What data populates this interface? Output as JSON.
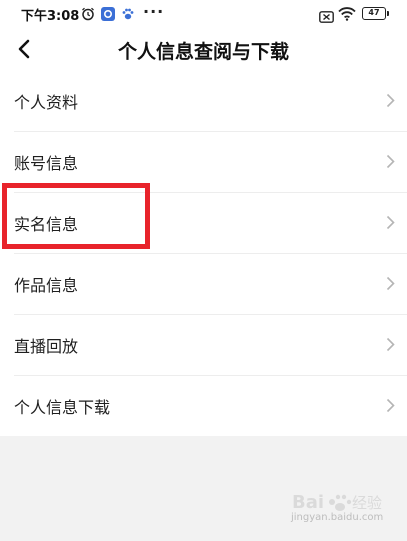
{
  "status_bar": {
    "time": "下午3:08",
    "icons": [
      "alarm-icon",
      "app-notification-icon",
      "paw-app-icon",
      "more-dots-icon",
      "sim-disabled-icon",
      "wifi-icon"
    ],
    "more": "···",
    "battery": "47"
  },
  "header": {
    "back_icon": "chevron-left-icon",
    "title": "个人信息查阅与下载"
  },
  "list": {
    "items": [
      {
        "label": "个人资料"
      },
      {
        "label": "账号信息"
      },
      {
        "label": "实名信息"
      },
      {
        "label": "作品信息"
      },
      {
        "label": "直播回放"
      },
      {
        "label": "个人信息下载"
      }
    ]
  },
  "annotation": {
    "color": "#e8232b",
    "highlighted_item": "实名信息"
  },
  "colors": {
    "background": "#f2f2f2",
    "surface": "#ffffff",
    "text": "#1f1f1f",
    "chevron": "#b5b5b5"
  }
}
